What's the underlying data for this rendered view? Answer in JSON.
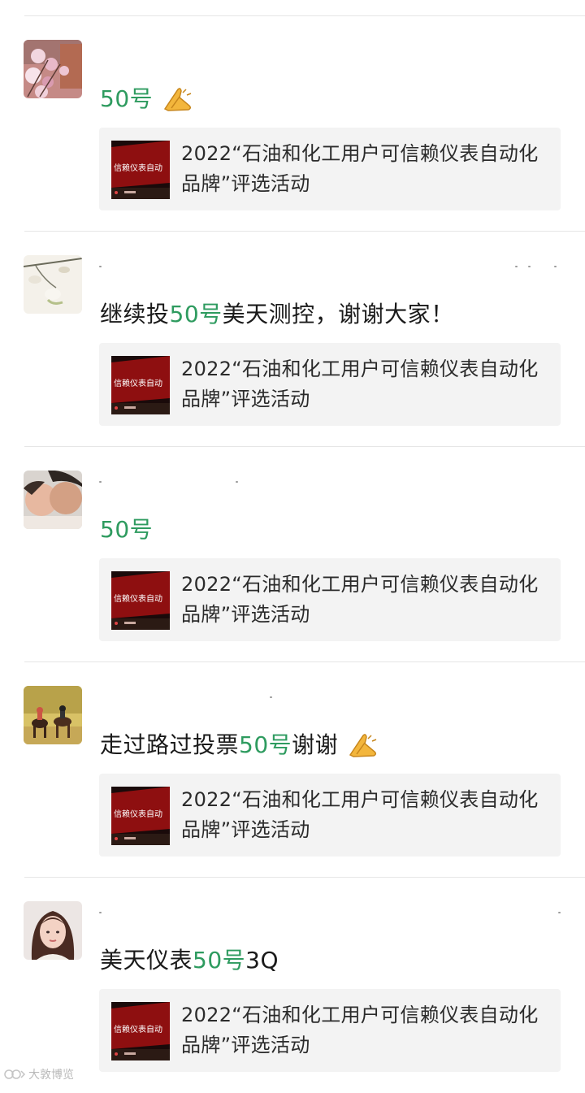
{
  "feed": {
    "posts": [
      {
        "message_prefix": "",
        "message_number": "50号",
        "message_suffix": "",
        "emoji": "pray-hands",
        "card_title": "2022“石油和化工用户可信赖仪表自动化品牌”评选活动",
        "thumb_text": "信赖仪表自动"
      },
      {
        "message_prefix": "继续投",
        "message_number": "50号",
        "message_suffix": "美天测控，谢谢大家！",
        "emoji": "",
        "card_title": "2022“石油和化工用户可信赖仪表自动化品牌”评选活动",
        "thumb_text": "信赖仪表自动"
      },
      {
        "message_prefix": "",
        "message_number": "50号",
        "message_suffix": "",
        "emoji": "",
        "card_title": "2022“石油和化工用户可信赖仪表自动化品牌”评选活动",
        "thumb_text": "信赖仪表自动"
      },
      {
        "message_prefix": "走过路过投票",
        "message_number": "50号",
        "message_suffix": "谢谢",
        "emoji": "pray-hands",
        "card_title": "2022“石油和化工用户可信赖仪表自动化品牌”评选活动",
        "thumb_text": "信赖仪表自动"
      },
      {
        "message_prefix": "美天仪表",
        "message_number": "50号",
        "message_suffix": "3Q",
        "emoji": "",
        "card_title": "2022“石油和化工用户可信赖仪表自动化品牌”评选活动",
        "thumb_text": "信赖仪表自动"
      }
    ]
  },
  "watermark": {
    "text": "大敦博览"
  },
  "colors": {
    "number_green": "#2e9b5f",
    "card_bg": "#f3f3f3",
    "divider": "#e6e6e6",
    "thumb_red": "#8e0f10"
  }
}
